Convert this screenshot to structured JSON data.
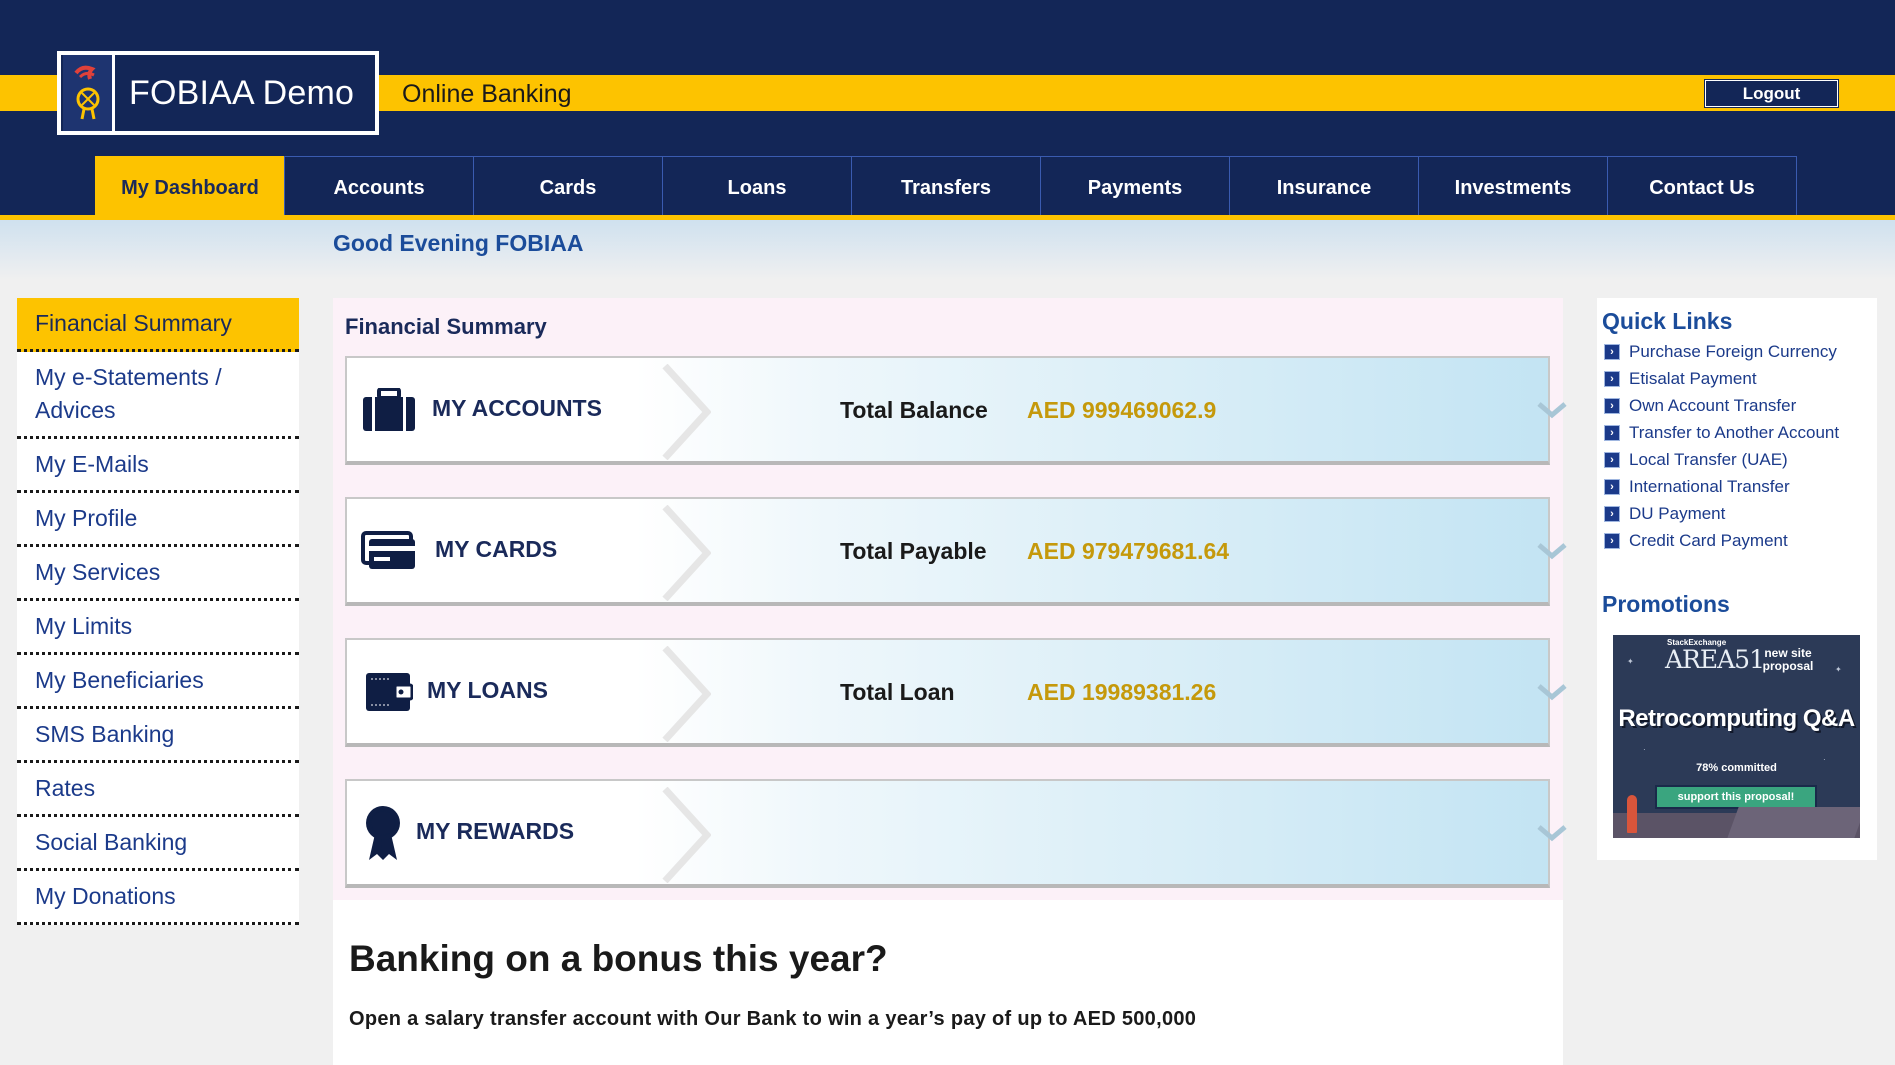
{
  "header": {
    "logo_text": "FOBIAA Demo",
    "subtitle": "Online Banking",
    "logout_label": "Logout"
  },
  "nav": {
    "items": [
      {
        "label": "My Dashboard",
        "active": true
      },
      {
        "label": "Accounts"
      },
      {
        "label": "Cards"
      },
      {
        "label": "Loans"
      },
      {
        "label": "Transfers"
      },
      {
        "label": "Payments"
      },
      {
        "label": "Insurance"
      },
      {
        "label": "Investments"
      },
      {
        "label": "Contact Us"
      }
    ]
  },
  "greeting": "Good Evening FOBIAA",
  "sidebar": {
    "items": [
      {
        "label": "Financial Summary",
        "active": true
      },
      {
        "label": "My e-Statements / Advices"
      },
      {
        "label": "My E-Mails"
      },
      {
        "label": "My Profile"
      },
      {
        "label": "My Services"
      },
      {
        "label": "My Limits"
      },
      {
        "label": "My Beneficiaries"
      },
      {
        "label": "SMS Banking"
      },
      {
        "label": "Rates"
      },
      {
        "label": "Social Banking"
      },
      {
        "label": "My Donations"
      }
    ]
  },
  "summary": {
    "title": "Financial Summary",
    "rows": [
      {
        "label": "MY ACCOUNTS",
        "icon": "briefcase-icon",
        "total_label": "Total Balance",
        "total_value": "AED 999469062.9"
      },
      {
        "label": "MY CARDS",
        "icon": "credit-card-icon",
        "total_label": "Total Payable",
        "total_value": "AED 979479681.64"
      },
      {
        "label": "MY LOANS",
        "icon": "wallet-icon",
        "total_label": "Total Loan",
        "total_value": "AED 19989381.26"
      },
      {
        "label": "MY REWARDS",
        "icon": "award-ribbon-icon",
        "total_label": "",
        "total_value": ""
      }
    ]
  },
  "promo": {
    "heading": "Banking on a bonus this year?",
    "text": "Open a salary transfer account with Our Bank to win a year’s pay of up to AED 500,000"
  },
  "quick_links": {
    "title": "Quick Links",
    "items": [
      "Purchase Foreign Currency",
      "Etisalat Payment",
      "Own Account Transfer",
      "Transfer to Another Account",
      "Local Transfer (UAE)",
      "International Transfer",
      "DU Payment",
      "Credit Card Payment"
    ]
  },
  "promotions": {
    "title": "Promotions",
    "ad": {
      "brand_small": "StackExchange",
      "brand": "AREA51",
      "tag": "new site proposal",
      "title": "Retrocomputing Q&A",
      "committed": "78% committed",
      "button": "support this proposal!"
    }
  },
  "colors": {
    "navy": "#132657",
    "yellow": "#fdc300",
    "link_blue": "#1b3a8a",
    "amount_gold": "#c5990b"
  }
}
